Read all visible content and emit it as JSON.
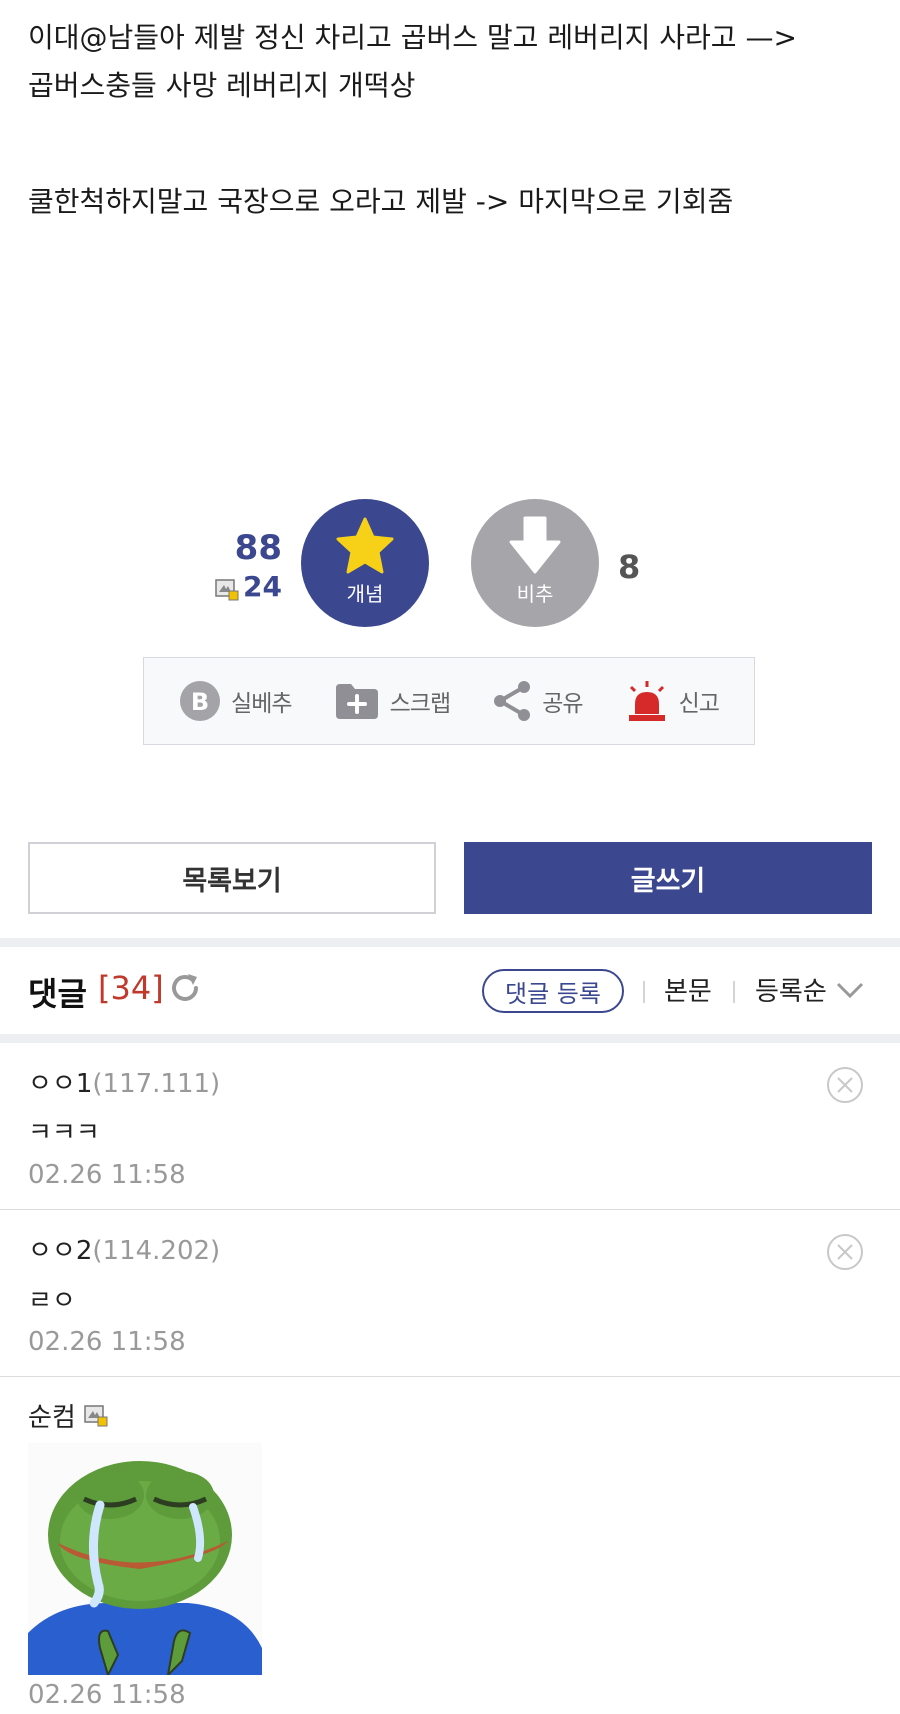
{
  "post": {
    "lines": [
      "이대@남들아 제발 정신 차리고 곱버스 말고 레버리지 사라고 —>",
      "곱버스충들 사망 레버리지 개떡상",
      "쿨한척하지말고 국장으로 오라고 제발 -> 마지막으로 기회줌"
    ]
  },
  "vote": {
    "up_count": "88",
    "fix_count": "24",
    "up_label": "개념",
    "down_label": "비추",
    "down_count": "8",
    "up_color": "#3b4890",
    "down_color": "#a5a5aa",
    "star_color": "#f7d117"
  },
  "actions": {
    "best": "실베추",
    "scrap": "스크랩",
    "share": "공유",
    "report": "신고",
    "report_color": "#d62a2a"
  },
  "buttons": {
    "list": "목록보기",
    "write": "글쓰기"
  },
  "comments_header": {
    "title": "댓글",
    "count": "[34]",
    "register": "댓글 등록",
    "body": "본문",
    "sort": "등록순"
  },
  "comments": [
    {
      "nick": "ㅇㅇ1",
      "ip": "(117.111)",
      "text": "ㅋㅋㅋ",
      "date": "02.26 11:58"
    },
    {
      "nick": "ㅇㅇ2",
      "ip": "(114.202)",
      "text": "ㄹㅇ",
      "date": "02.26 11:58"
    },
    {
      "nick": "순컴",
      "date": "02.26 11:58",
      "image": "crying-frog-meme"
    }
  ]
}
